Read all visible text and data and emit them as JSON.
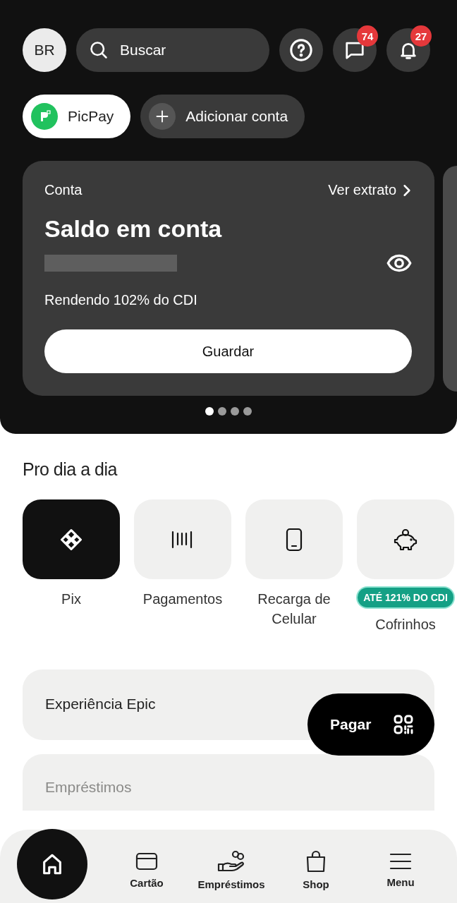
{
  "header": {
    "avatar_initials": "BR",
    "search": {
      "placeholder": "Buscar"
    },
    "chat_badge": "74",
    "notifications_badge": "27"
  },
  "accounts": [
    {
      "label": "PicPay",
      "kind": "account",
      "selected": true
    },
    {
      "label": "Adicionar conta",
      "kind": "add",
      "selected": false
    }
  ],
  "balance_card": {
    "label": "Conta",
    "link": "Ver extrato",
    "title": "Saldo em conta",
    "balance_hidden": true,
    "yield": "Rendendo 102% do CDI",
    "button": "Guardar"
  },
  "carousel": [
    {
      "selected": true
    },
    {
      "selected": false
    },
    {
      "selected": false
    },
    {
      "selected": false
    }
  ],
  "section_title": "Pro dia a dia",
  "quick_actions": [
    {
      "label": "Pix",
      "kind": "featured"
    },
    {
      "label": "Pagamentos",
      "kind": "standard"
    },
    {
      "label": "Recarga de Celular",
      "kind": "standard"
    },
    {
      "label": "Cofrinhos",
      "kind": "standard",
      "badge": "ATÉ 121% DO CDI"
    }
  ],
  "cards": [
    {
      "title": "Experiência Epic",
      "faded": false
    },
    {
      "title": "Empréstimos",
      "faded": true
    }
  ],
  "pay_button": "Pagar",
  "bottom_nav": [
    {
      "selected": true
    },
    {
      "label": "Cartão",
      "selected": false
    },
    {
      "label": "Empréstimos",
      "selected": false
    },
    {
      "label": "Shop",
      "selected": false
    },
    {
      "label": "Menu",
      "selected": false
    }
  ]
}
